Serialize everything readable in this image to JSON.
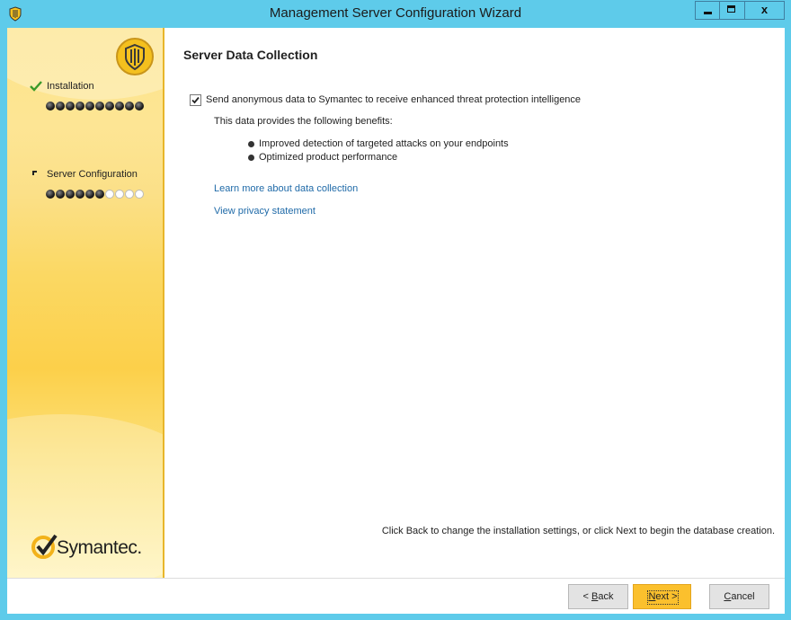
{
  "window": {
    "title": "Management Server Configuration Wizard",
    "controls": {
      "minimize": "minimize",
      "maximize": "maximize",
      "close": "x"
    }
  },
  "sidebar": {
    "steps": [
      {
        "label": "Installation",
        "status": "complete",
        "icon": "checkmark-icon",
        "progress": {
          "done": 10,
          "total": 10
        }
      },
      {
        "label": "Server Configuration",
        "status": "current",
        "icon": "current-step-icon",
        "progress": {
          "done": 6,
          "total": 10
        }
      }
    ],
    "logo_text": "Symantec."
  },
  "main": {
    "heading": "Server Data Collection",
    "send_data_option": {
      "label": "Send anonymous data to Symantec to receive enhanced threat protection intelligence",
      "checked": true
    },
    "benefits_intro": "This data provides the following benefits:",
    "benefits": [
      "Improved detection of targeted attacks on your endpoints",
      "Optimized product performance"
    ],
    "links": {
      "learn_more": "Learn more about data collection",
      "privacy": "View privacy statement"
    },
    "hint": "Click Back to change the installation settings, or click Next to begin the database creation."
  },
  "footer": {
    "back": {
      "prefix": "< ",
      "mnemonic": "B",
      "rest": "ack"
    },
    "next": {
      "mnemonic": "N",
      "rest": "ext >"
    },
    "cancel": {
      "mnemonic": "C",
      "rest": "ancel"
    }
  },
  "colors": {
    "titlebar": "#5ecbea",
    "next_button": "#fbc02d",
    "link": "#1f6aa8",
    "sidebar": "#fcd04a"
  }
}
